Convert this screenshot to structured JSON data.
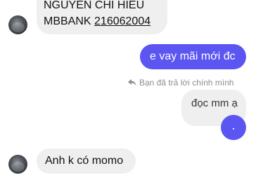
{
  "messages": {
    "bank_info": {
      "line1": "NGUYEN CHI HIEU",
      "bank": "MBBANK",
      "account": "216062004"
    },
    "sent_1": "e vay mãi mới đc",
    "reply_note": "Bạn đã trả lời chính mình",
    "quoted": "đọc mm ạ",
    "sent_2": ".",
    "received_2": "Anh k có momo"
  },
  "colors": {
    "accent": "#5b55f2",
    "incoming_bubble": "#efefef",
    "muted_text": "#8e8e93"
  },
  "icons": {
    "reply": "reply-arrow-icon",
    "avatar": "avatar"
  }
}
